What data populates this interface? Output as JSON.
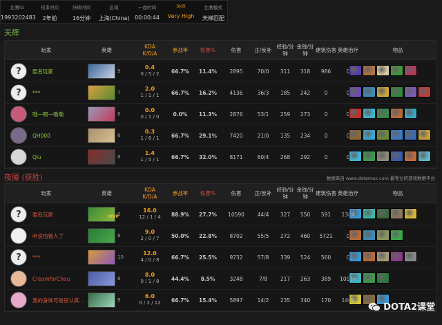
{
  "match": {
    "fields": [
      {
        "label": "比赛ID",
        "value": "1993202483",
        "highlight": false
      },
      {
        "label": "结束时间",
        "value": "2年前",
        "highlight": false
      },
      {
        "label": "持续时间",
        "value": "16分钟",
        "highlight": false
      },
      {
        "label": "区域",
        "value": "上海(China)",
        "highlight": false
      },
      {
        "label": "一血时间",
        "value": "00:00:44",
        "highlight": false
      },
      {
        "label": "Skill",
        "value": "Very High",
        "highlight": true
      },
      {
        "label": "比赛模式",
        "value": "天梯匹配",
        "highlight": false
      }
    ]
  },
  "headers": {
    "player": "玩家",
    "hero": "英雄",
    "kda_top": "KDA",
    "kda_bottom": "K/D/A",
    "participation": "参战率",
    "damage_pct": "伤害%",
    "damage": "伤害",
    "lh_dn": "正/反补",
    "xpm_top": "经验/分",
    "xpm_bottom": "钟",
    "gpm_top": "金钱/分",
    "gpm_bottom": "钟",
    "building": "建筑伤害",
    "healing": "英雄治疗",
    "items": "物品"
  },
  "radiant": {
    "title": "天辉",
    "players": [
      {
        "name": "匿名玩家",
        "anon": true,
        "avatar_color": "#ededed",
        "hero_colors": [
          "#3a6a9a",
          "#c8d0e0"
        ],
        "level": "9",
        "kda_ratio": "0.4",
        "kda": "0 / 5 / 2",
        "participation": "66.7%",
        "damage_pct": "11.4%",
        "damage": "2895",
        "lh_dn": "70/0",
        "xpm": "311",
        "gpm": "318",
        "building": "986",
        "healing": "0",
        "items": [
          "#5a3aa8",
          "#b5703a",
          "#d8c9a0",
          "#3e9a3a",
          "#b33a5a"
        ]
      },
      {
        "name": "***",
        "anon": true,
        "avatar_color": "#ededed",
        "hero_colors": [
          "#d8a040",
          "#5a8a30"
        ],
        "level": "7",
        "kda_ratio": "2.0",
        "kda": "1 / 1 / 1",
        "participation": "66.7%",
        "damage_pct": "16.2%",
        "damage": "4136",
        "lh_dn": "36/3",
        "xpm": "185",
        "gpm": "242",
        "building": "0",
        "healing": "0",
        "items": [
          "#6a4ab8",
          "#3a8ab8",
          "#c9a73a",
          "#2f8a3a",
          "#7a5ab8",
          "#c23a3a"
        ]
      },
      {
        "name": "哦一啊一嘞嘞",
        "anon": false,
        "avatar_color": "#c85a7a",
        "hero_colors": [
          "#9a9ab8",
          "#c03a5a"
        ],
        "level": "8",
        "kda_ratio": "0.0",
        "kda": "0 / 1 / 0",
        "participation": "0.0%",
        "damage_pct": "11.3%",
        "damage": "2876",
        "lh_dn": "53/1",
        "xpm": "259",
        "gpm": "273",
        "building": "0",
        "healing": "0",
        "items": [
          "#c0302a",
          "#3ab8d0",
          "#3a8a4a",
          "#b86a3a",
          "#3aa8c8"
        ]
      },
      {
        "name": "QH000",
        "anon": false,
        "avatar_color": "#7a6a8a",
        "hero_colors": [
          "#a89070",
          "#d8c090"
        ],
        "level": "6",
        "kda_ratio": "0.3",
        "kda": "1 / 6 / 1",
        "participation": "66.7%",
        "damage_pct": "29.1%",
        "damage": "7420",
        "lh_dn": "21/0",
        "xpm": "135",
        "gpm": "234",
        "building": "0",
        "healing": "0",
        "items": [
          "#8a6a3a",
          "#3aa8d8",
          "#6a8a3a",
          "#3a7ac8",
          "#3a6ab8",
          "#c8a03a"
        ]
      },
      {
        "name": "Qiu",
        "anon": false,
        "avatar_color": "#d8d8d8",
        "hero_colors": [
          "#8a2a2a",
          "#4a4a4a"
        ],
        "level": "8",
        "kda_ratio": "1.4",
        "kda": "1 / 5 / 1",
        "participation": "66.7%",
        "damage_pct": "32.0%",
        "damage": "8171",
        "lh_dn": "60/4",
        "xpm": "268",
        "gpm": "292",
        "building": "0",
        "healing": "0",
        "items": [
          "#3ab8d8",
          "#3a9a4a",
          "#8a8a7a",
          "#3a5aa8",
          "#c86a3a",
          "#5ab8c8"
        ]
      }
    ]
  },
  "dire": {
    "title": "夜魇",
    "result": "(获胜)",
    "source": "数据来自 www.dotamax.com 最专业的游戏数据平台",
    "players": [
      {
        "name": "匿名玩家",
        "anon": true,
        "avatar_color": "#ededed",
        "hero_colors": [
          "#3a8a3a",
          "#8ab83a"
        ],
        "level": "9",
        "mvp": "MVP",
        "kda_ratio": "16.0",
        "kda": "12 / 1 / 4",
        "participation": "88.9%",
        "damage_pct": "27.7%",
        "damage": "10590",
        "lh_dn": "44/4",
        "xpm": "327",
        "gpm": "550",
        "building": "591",
        "healing": "1384",
        "items": [
          "#3a9ad8",
          "#3ab8a8",
          "#3a6a3a",
          "#8a7a5a",
          "#d8b83a"
        ]
      },
      {
        "name": "听说怕猫人了",
        "anon": false,
        "avatar_color": "#f0f0f0",
        "hero_colors": [
          "#2a7a3a",
          "#4aa84a"
        ],
        "level": "8",
        "mvp": "",
        "kda_ratio": "9.0",
        "kda": "2 / 0 / 7",
        "participation": "50.0%",
        "damage_pct": "22.8%",
        "damage": "8702",
        "lh_dn": "55/5",
        "xpm": "272",
        "gpm": "460",
        "building": "5721",
        "healing": "0",
        "items": [
          "#b86a3a",
          "#3a8ab8",
          "#8a9a5a",
          "#3aa84a"
        ]
      },
      {
        "name": "***",
        "anon": true,
        "avatar_color": "#ededed",
        "hero_colors": [
          "#d89a3a",
          "#8a5ab8"
        ],
        "level": "10",
        "mvp": "",
        "kda_ratio": "12.0",
        "kda": "4 / 0 / 8",
        "participation": "66.7%",
        "damage_pct": "25.5%",
        "damage": "9732",
        "lh_dn": "57/8",
        "xpm": "339",
        "gpm": "524",
        "building": "560",
        "healing": "0",
        "items": [
          "#3a9ad8",
          "#b86a3a",
          "#a89a7a",
          "#8a3a8a",
          "#8a8a8a"
        ]
      },
      {
        "name": "CreamforChou",
        "anon": false,
        "avatar_color": "#e8b898",
        "hero_colors": [
          "#4a5aa8",
          "#8a9ad8"
        ],
        "level": "8",
        "mvp": "",
        "kda_ratio": "8.0",
        "kda": "0 / 1 / 8",
        "participation": "44.4%",
        "damage_pct": "8.5%",
        "damage": "3248",
        "lh_dn": "7/8",
        "xpm": "217",
        "gpm": "263",
        "building": "389",
        "healing": "10956",
        "items": [
          "#3ab8c8",
          "#3a9a4a",
          "#2a7a3a"
        ]
      },
      {
        "name": "我的身体可是很认真...",
        "anon": false,
        "avatar_color": "#e8a8c8",
        "hero_colors": [
          "#3a6a4a",
          "#9ad8b8"
        ],
        "level": "8",
        "mvp": "",
        "kda_ratio": "6.0",
        "kda": "0 / 2 / 12",
        "participation": "66.7%",
        "damage_pct": "15.4%",
        "damage": "5897",
        "lh_dn": "14/2",
        "xpm": "235",
        "gpm": "340",
        "building": "170",
        "healing": "1409",
        "items": [
          "#d8c83a",
          "#8a6a3a",
          "#3a9ad8"
        ]
      }
    ]
  },
  "watermark": {
    "text": "DOTA2课堂",
    "icon": "wechat-icon"
  },
  "colors": {
    "radiant": "#7ab84a",
    "dire": "#c0413f",
    "accent": "#f29a1f"
  }
}
